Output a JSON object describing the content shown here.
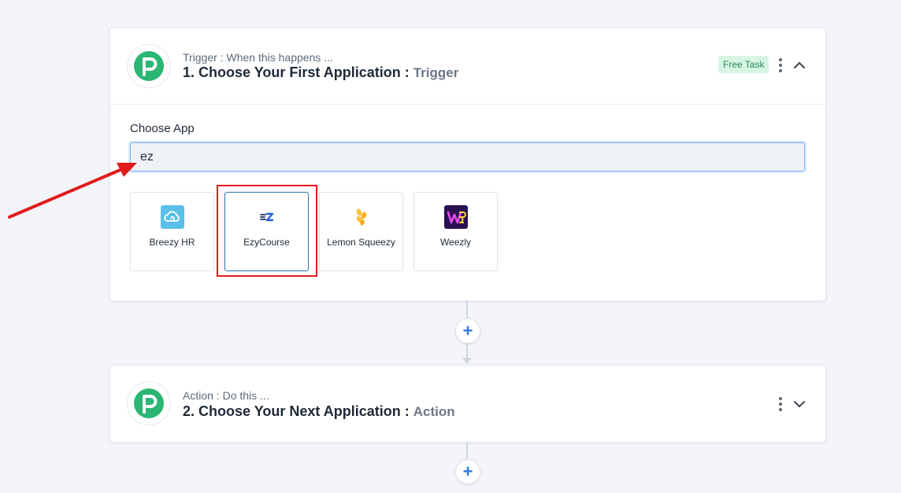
{
  "trigger_step": {
    "subtitle": "Trigger : When this happens ...",
    "title": "1. Choose Your First Application :",
    "title_accent": "Trigger",
    "badge": "Free Task",
    "choose_label": "Choose App",
    "search_value": "ez",
    "apps": [
      {
        "name": "Breezy HR",
        "icon": "breezy-hr-icon",
        "selected": false
      },
      {
        "name": "EzyCourse",
        "icon": "ezycourse-icon",
        "selected": true
      },
      {
        "name": "Lemon Squeezy",
        "icon": "lemon-squeezy-icon",
        "selected": false
      },
      {
        "name": "Weezly",
        "icon": "weezly-icon",
        "selected": false
      }
    ]
  },
  "action_step": {
    "subtitle": "Action : Do this ...",
    "title": "2. Choose Your Next Application :",
    "title_accent": "Action"
  },
  "add_step": {
    "label": "+"
  },
  "colors": {
    "brand_green": "#2bb673",
    "accent_blue": "#2f7be0",
    "highlight_red": "#e11b1b",
    "badge_bg": "#d7f5e4",
    "badge_text": "#2d8a57"
  }
}
